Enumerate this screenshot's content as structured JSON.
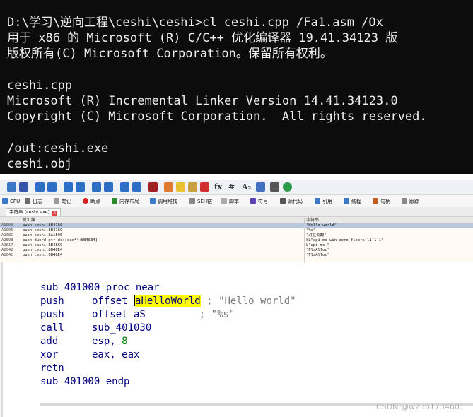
{
  "console": {
    "lines": [
      "D:\\学习\\逆向工程\\ceshi\\ceshi>cl ceshi.cpp /Fa1.asm /Ox",
      "用于 x86 的 Microsoft (R) C/C++ 优化编译器 19.41.34123 版",
      "版权所有(C) Microsoft Corporation。保留所有权利。",
      "",
      "ceshi.cpp",
      "Microsoft (R) Incremental Linker Version 14.41.34123.0",
      "Copyright (C) Microsoft Corporation.  All rights reserved.",
      "",
      "/out:ceshi.exe",
      "ceshi.obj"
    ]
  },
  "debugger": {
    "toolbar_icons": [
      "refresh-icon",
      "stop-icon",
      "run-icon",
      "step-into-icon",
      "step-over-icon",
      "step-out-icon",
      "run-to-icon",
      "return-icon",
      "animate-icon",
      "trace-icon",
      "memory-icon",
      "patch-icon",
      "highlight-icon",
      "bookmark-icon",
      "function-icon",
      "hash-icon",
      "font-icon",
      "script-icon",
      "calculator-icon",
      "info-icon"
    ],
    "toolbar_text": {
      "fx": "fx",
      "hash": "#",
      "az": "A₂"
    },
    "tabs": [
      {
        "label": "CPU",
        "color": "#3c78c8"
      },
      {
        "label": "日志",
        "color": "#6a6a6a"
      },
      {
        "label": "笔记",
        "color": "#9a9a9a"
      },
      {
        "label": "断点",
        "color": "#d02020"
      },
      {
        "label": "内存布局",
        "color": "#2a8a2a"
      },
      {
        "label": "调用堆栈",
        "color": "#3c78c8"
      },
      {
        "label": "SEH链",
        "color": "#888888"
      },
      {
        "label": "脚本",
        "color": "#aaaaaa"
      },
      {
        "label": "符号",
        "color": "#6040b0"
      },
      {
        "label": "源代码",
        "color": "#555555"
      },
      {
        "label": "引用",
        "color": "#3c78c8"
      },
      {
        "label": "线程",
        "color": "#3c78c8"
      },
      {
        "label": "句柄",
        "color": "#c06020"
      },
      {
        "label": "跟踪",
        "color": "#888888"
      }
    ],
    "subtab": {
      "label": "字符串 (ceshi.exe)",
      "close": "x"
    },
    "grid": {
      "columns": [
        "",
        "反汇编",
        "字符串"
      ],
      "rows": [
        {
          "addr": "A1000",
          "dis": "push ceshi.8B4160",
          "str": "\"Hello world\""
        },
        {
          "addr": "A1005",
          "dis": "push ceshi.8B416C",
          "str": "\"%s\""
        },
        {
          "addr": "A108C",
          "dis": "push ceshi.8A1596",
          "str": "\"对立调翻\""
        },
        {
          "addr": "A2598",
          "dis": "push dword ptr ds:[ecx*4+8B4834]",
          "str": "&L\"api-ms-win-core-fibers-l1-1-1\""
        },
        {
          "addr": "A2617",
          "dis": "push ceshi.8B48CC",
          "str": "L\"api-ms-\""
        },
        {
          "addr": "A2642",
          "dis": "push ceshi.8B48E4",
          "str": "\"FlsAlloc\""
        },
        {
          "addr": "A264C",
          "dis": "push ceshi.8B48E4",
          "str": "\"FlsAlloc\""
        }
      ]
    }
  },
  "ida": {
    "lines": [
      {
        "mn": "sub_401000 proc near",
        "op": "",
        "hl": "",
        "cm": "",
        "num": ""
      },
      {
        "mn": "push",
        "op": "offset ",
        "hl": "aHelloWorld",
        "cm": " ; \"Hello world\"",
        "num": ""
      },
      {
        "mn": "push",
        "op": "offset aS",
        "hl": "",
        "cm": "         ; \"%s\"",
        "num": ""
      },
      {
        "mn": "call",
        "op": "sub_401030",
        "hl": "",
        "cm": "",
        "num": ""
      },
      {
        "mn": "add",
        "op": "esp, ",
        "hl": "",
        "cm": "",
        "num": "8"
      },
      {
        "mn": "xor",
        "op": "eax, eax",
        "hl": "",
        "cm": "",
        "num": ""
      },
      {
        "mn": "retn",
        "op": "",
        "hl": "",
        "cm": "",
        "num": ""
      },
      {
        "mn": "sub_401000 endp",
        "op": "",
        "hl": "",
        "cm": "",
        "num": ""
      }
    ],
    "watermark": "CSDN @w2361734601"
  },
  "colors": {
    "console_bg": "#0c0c0c",
    "console_fg": "#eeeeee",
    "ida_code": "#00007f",
    "ida_highlight": "#ffff00",
    "ida_number": "#008000",
    "ida_comment": "#7c7c7c"
  }
}
